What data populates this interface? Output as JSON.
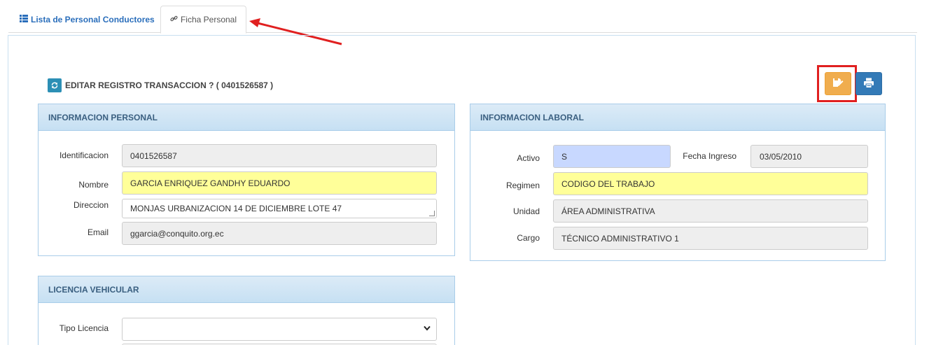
{
  "tabs": {
    "list_label": "Lista de Personal Conductores",
    "ficha_label": "Ficha Personal"
  },
  "title": "EDITAR REGISTRO TRANSACCION ? ( 0401526587 )",
  "personal": {
    "heading": "INFORMACION PERSONAL",
    "identificacion_label": "Identificacion",
    "identificacion_value": "0401526587",
    "nombre_label": "Nombre",
    "nombre_value": "GARCIA ENRIQUEZ GANDHY EDUARDO",
    "direccion_label": "Direccion",
    "direccion_value": "MONJAS URBANIZACION 14 DE DICIEMBRE LOTE 47",
    "email_label": "Email",
    "email_value": "ggarcia@conquito.org.ec"
  },
  "laboral": {
    "heading": "INFORMACION LABORAL",
    "activo_label": "Activo",
    "activo_value": "S",
    "fecha_label": "Fecha Ingreso",
    "fecha_value": "03/05/2010",
    "regimen_label": "Regimen",
    "regimen_value": "CODIGO DEL TRABAJO",
    "unidad_label": "Unidad",
    "unidad_value": "ÁREA ADMINISTRATIVA",
    "cargo_label": "Cargo",
    "cargo_value": "TÉCNICO ADMINISTRATIVO 1"
  },
  "licencia": {
    "heading": "LICENCIA VEHICULAR",
    "tipo_label": "Tipo Licencia",
    "tipo_value": ""
  },
  "colors": {
    "save_button": "#f0ad4e",
    "print_button": "#337ab7",
    "highlight": "#e02020"
  },
  "icons": [
    "list-icon",
    "link-icon",
    "refresh-icon",
    "save-edit-icon",
    "print-icon",
    "chevron-down-icon"
  ]
}
